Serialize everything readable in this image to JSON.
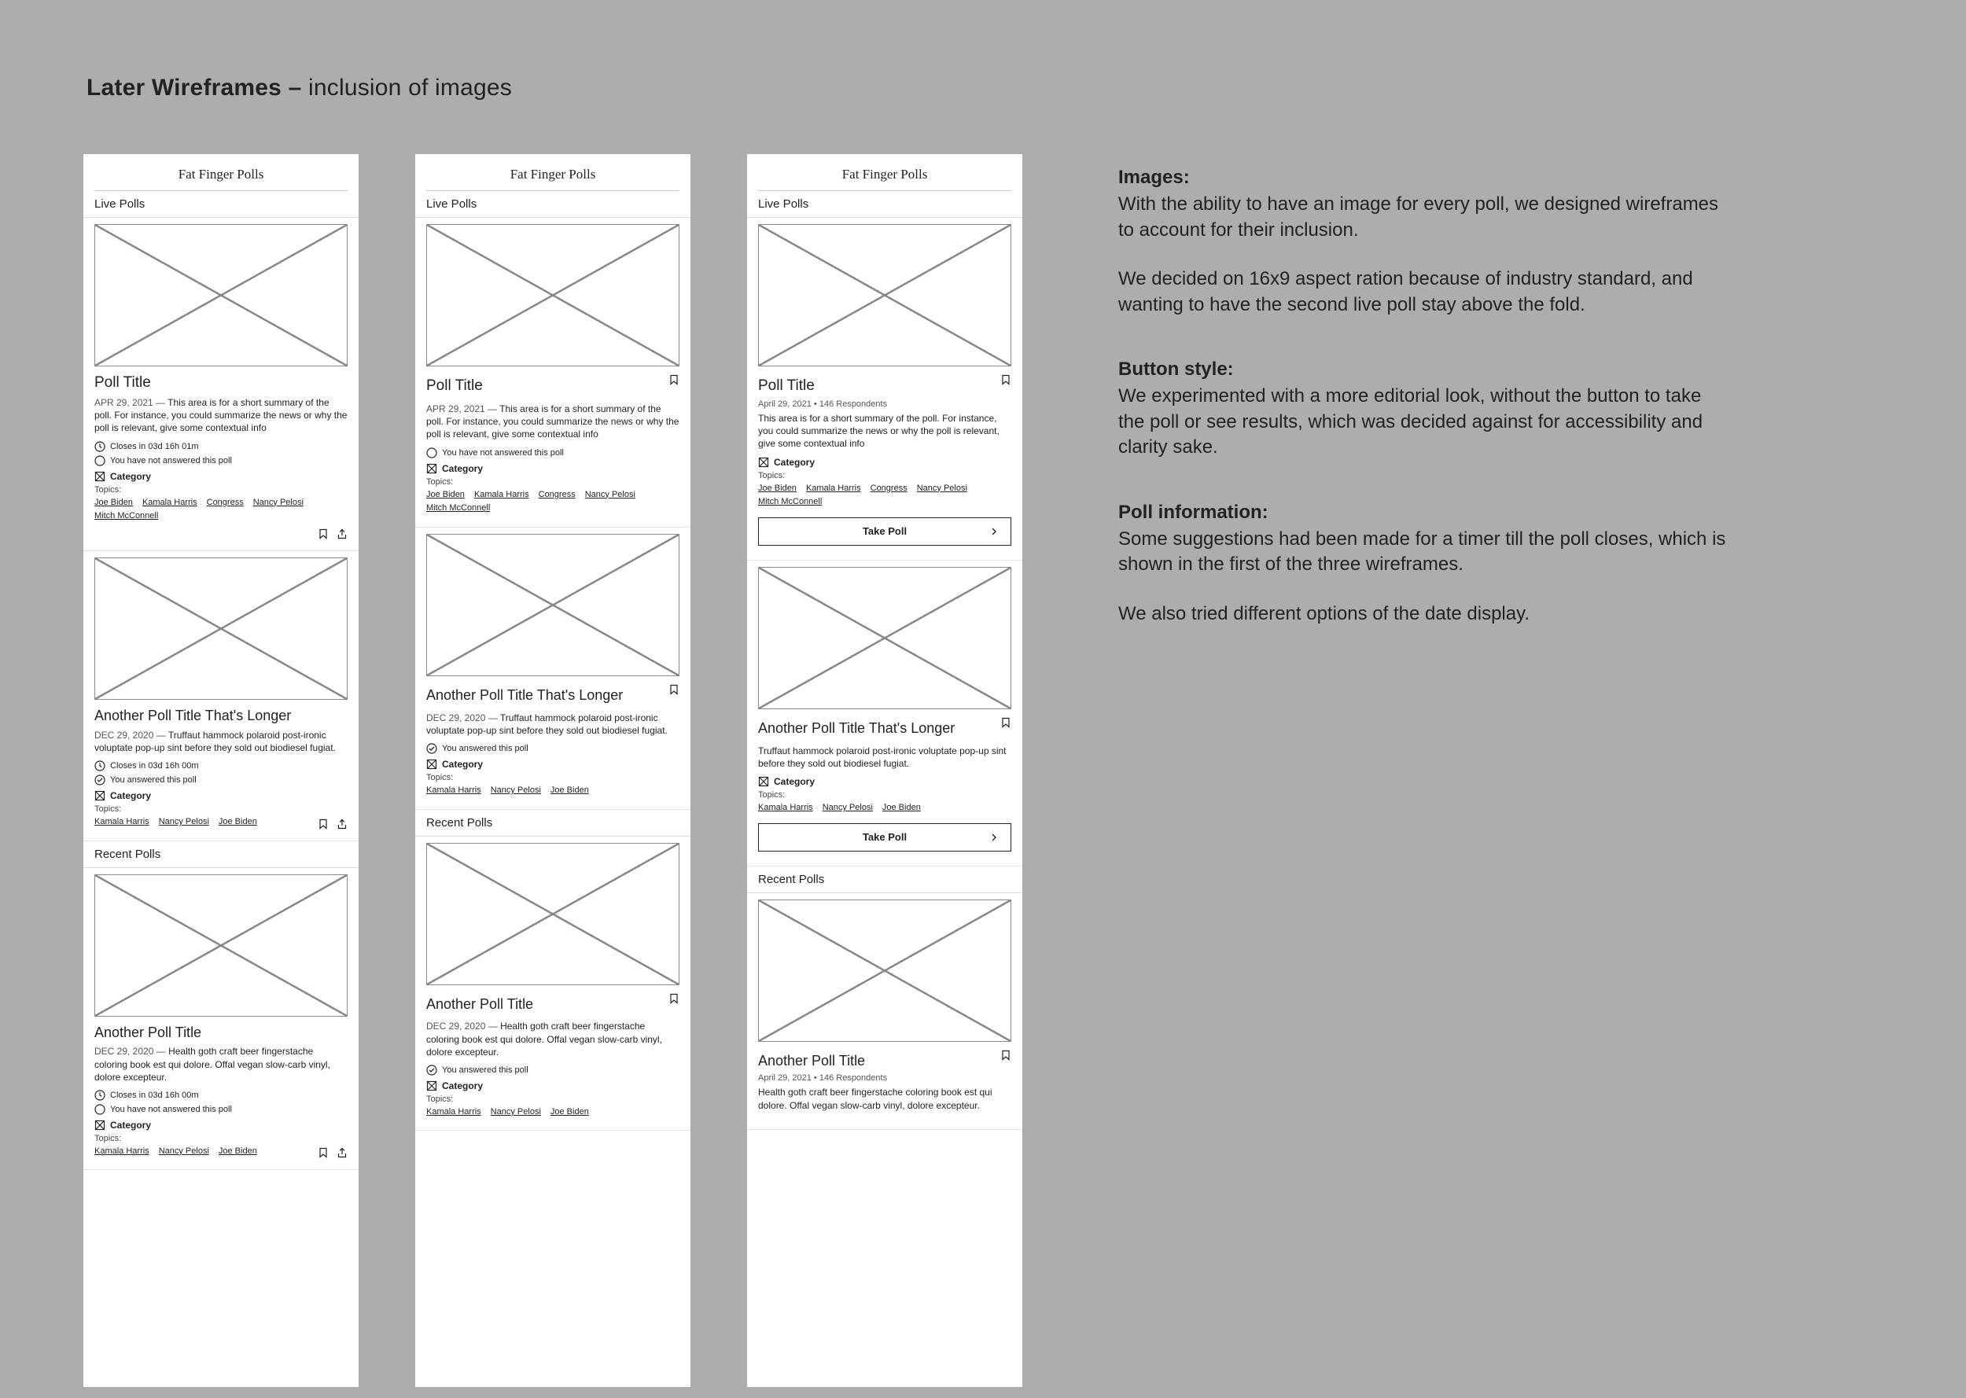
{
  "page": {
    "title_bold": "Later Wireframes –",
    "title_light": " inclusion of images"
  },
  "right": {
    "images_h": "Images:",
    "images_p1": "With the ability to have an image for every poll, we designed wireframes to account for their inclusion.",
    "images_p2": "We decided on 16x9 aspect ration because of industry standard, and wanting to have the second live poll stay above the fold.",
    "button_h": "Button style:",
    "button_p": "We experimented with a more editorial look, without the button to take the poll or see results, which was decided against for accessibility and clarity sake.",
    "info_h": "Poll information:",
    "info_p1": "Some suggestions had been made for a timer till the poll closes, which is shown in the first of the three wireframes.",
    "info_p2": "We also tried different options of the date display."
  },
  "common": {
    "app_title": "Fat Finger Polls",
    "live_polls": "Live Polls",
    "recent_polls": "Recent Polls",
    "category": "Category",
    "topics_label": "Topics:",
    "take_poll": "Take Poll"
  },
  "status": {
    "closes_1": "Closes in 03d 16h 01m",
    "not_answered": "You have not answered this poll",
    "closes_2": "Closes in 03d 16h 00m",
    "answered_short": "You answered this poll",
    "closes_3": "Closes in 03d 16h 00m",
    "not_answered_3": "You have not answered this poll"
  },
  "f1": {
    "p1": {
      "title": "Poll Title",
      "date": "APR 29, 2021 — ",
      "summary": "This area is for a short summary of the poll. For instance, you could summarize the news or why the poll is relevant, give some contextual info",
      "topics": [
        "Joe Biden",
        "Kamala Harris",
        "Congress",
        "Nancy Pelosi",
        "Mitch McConnell"
      ]
    },
    "p2": {
      "title": "Another Poll Title That's Longer",
      "date": "DEC 29, 2020 — ",
      "summary": "Truffaut hammock polaroid post-ironic voluptate pop-up sint before they sold out biodiesel fugiat.",
      "topics": [
        "Kamala Harris",
        "Nancy Pelosi",
        "Joe Biden"
      ]
    },
    "p3": {
      "title": "Another Poll Title",
      "date": "DEC 29, 2020 — ",
      "summary": "Health goth craft beer fingerstache coloring book est qui dolore. Offal vegan slow-carb vinyl, dolore excepteur.",
      "topics": [
        "Kamala Harris",
        "Nancy Pelosi",
        "Joe Biden"
      ]
    }
  },
  "f2": {
    "p1": {
      "title": "Poll Title",
      "date": "APR 29, 2021 — ",
      "summary": "This area is for a short summary of the poll. For instance, you could summarize the news or why the poll is relevant, give some contextual info",
      "topics": [
        "Joe Biden",
        "Kamala Harris",
        "Congress",
        "Nancy Pelosi",
        "Mitch McConnell"
      ]
    },
    "p2": {
      "title": "Another Poll Title That's Longer",
      "date": "DEC 29, 2020 — ",
      "summary": "Truffaut hammock polaroid post-ironic voluptate pop-up sint before they sold out biodiesel fugiat.",
      "topics": [
        "Kamala Harris",
        "Nancy Pelosi",
        "Joe Biden"
      ]
    },
    "p3": {
      "title": "Another Poll Title",
      "date": "DEC 29, 2020 — ",
      "summary": "Health goth craft beer fingerstache coloring book est qui dolore. Offal vegan slow-carb vinyl, dolore excepteur.",
      "topics": [
        "Kamala Harris",
        "Nancy Pelosi",
        "Joe Biden"
      ]
    }
  },
  "f3": {
    "p1": {
      "title": "Poll Title",
      "meta": "April 29, 2021  •  146 Respondents",
      "summary": "This area is for a short summary of the poll. For instance, you could summarize the news or why the poll is relevant, give some contextual info",
      "topics": [
        "Joe Biden",
        "Kamala Harris",
        "Congress",
        "Nancy Pelosi",
        "Mitch McConnell"
      ]
    },
    "p2": {
      "title": "Another Poll Title That's Longer",
      "summary": "Truffaut hammock polaroid post-ironic voluptate pop-up sint before they sold out biodiesel fugiat.",
      "topics": [
        "Kamala Harris",
        "Nancy Pelosi",
        "Joe Biden"
      ]
    },
    "p3": {
      "title": "Another Poll Title",
      "meta": "April 29, 2021  •  146 Respondents",
      "summary": "Health goth craft beer fingerstache coloring book est qui dolore. Offal vegan slow-carb vinyl, dolore excepteur."
    }
  }
}
